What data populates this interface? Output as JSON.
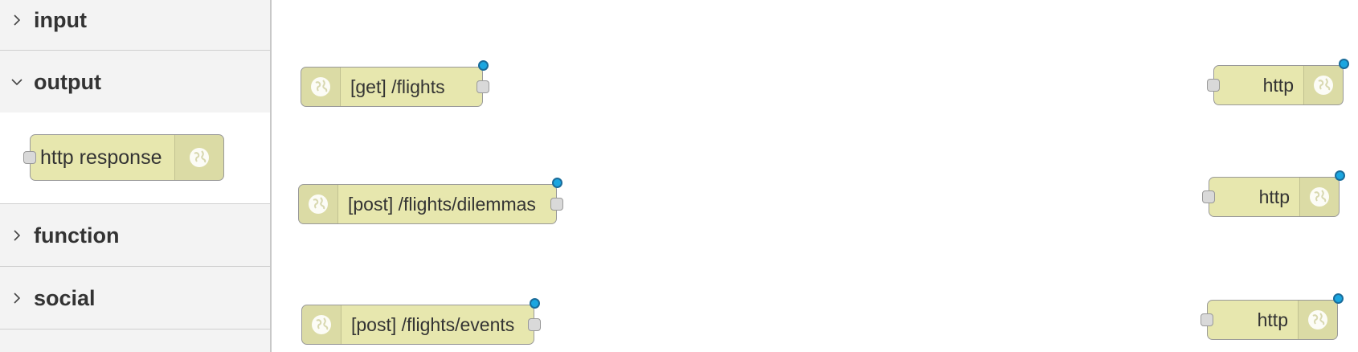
{
  "palette": {
    "categories": [
      {
        "id": "input",
        "label": "input",
        "expanded": false
      },
      {
        "id": "output",
        "label": "output",
        "expanded": true
      },
      {
        "id": "function",
        "label": "function",
        "expanded": false
      },
      {
        "id": "social",
        "label": "social",
        "expanded": false
      }
    ],
    "output_nodes": [
      {
        "label": "http response",
        "icon": "globe-icon"
      }
    ]
  },
  "workspace": {
    "http_in_nodes": [
      {
        "label": "[get] /flights",
        "icon": "globe-icon"
      },
      {
        "label": "[post] /flights/dilemmas",
        "icon": "globe-icon"
      },
      {
        "label": "[post] /flights/events",
        "icon": "globe-icon"
      }
    ],
    "http_response_nodes": [
      {
        "label": "http",
        "icon": "globe-icon"
      },
      {
        "label": "http",
        "icon": "globe-icon"
      },
      {
        "label": "http",
        "icon": "globe-icon"
      }
    ]
  },
  "colors": {
    "node_fill": "#e7e7ae",
    "status_dot": "#1aa6e0",
    "palette_bg": "#f3f3f3"
  }
}
